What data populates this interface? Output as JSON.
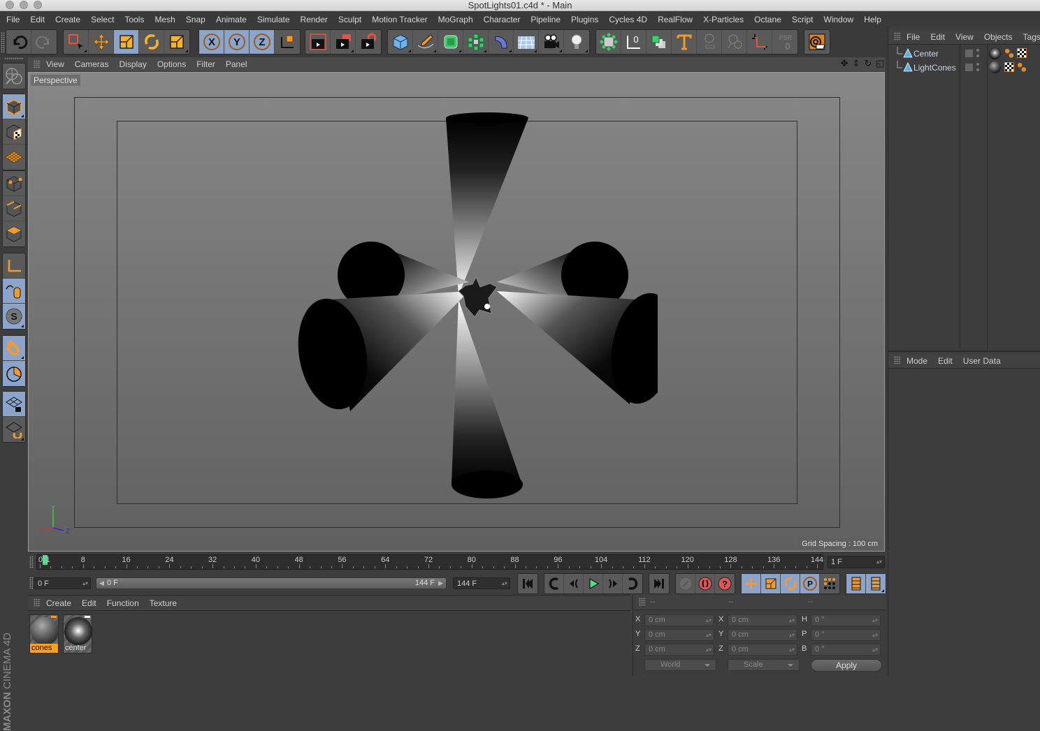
{
  "window": {
    "title": "SpotLights01.c4d * - Main"
  },
  "menubar": [
    "File",
    "Edit",
    "Create",
    "Select",
    "Tools",
    "Mesh",
    "Snap",
    "Animate",
    "Simulate",
    "Render",
    "Sculpt",
    "Motion Tracker",
    "MoGraph",
    "Character",
    "Pipeline",
    "Plugins",
    "Cycles 4D",
    "RealFlow",
    "X-Particles",
    "Octane",
    "Script",
    "Window",
    "Help"
  ],
  "toolbar": {
    "undo": "undo-icon",
    "redo": "redo-icon",
    "tools": [
      "live-selection-icon",
      "move-icon",
      "scale-icon",
      "rotate-icon",
      "last-tool-icon"
    ],
    "axis_locks": [
      "X",
      "Y",
      "Z"
    ],
    "coordinate_system": "world-coordinates-icon",
    "render": [
      "render-view-icon",
      "render-to-picture-viewer-icon",
      "render-settings-icon"
    ],
    "create": [
      "cube-icon",
      "pen-spline-icon",
      "subdivision-icon",
      "cloner-icon",
      "deformer-icon",
      "floor-icon",
      "camera-icon",
      "light-icon"
    ],
    "extra": [
      "xpresso-icon",
      "null-zero-icon",
      "instance-icon",
      "text-icon",
      "disabled-icon-1",
      "disabled-icon-2",
      "axis-icon",
      "psr-reset-icon"
    ],
    "psr_label": "PSR",
    "psr_value": "0",
    "octane": "octane-live-viewer-icon"
  },
  "left_tools": [
    "make-editable-icon",
    "model-mode-icon",
    "texture-mode-icon",
    "workplane-mode-icon",
    "points-mode-icon",
    "edges-mode-icon",
    "polygons-mode-icon",
    "axis-mode-icon",
    "tweak-mode-icon",
    "solo-mode-icon",
    "snap-icon",
    "quantize-icon",
    "lock-workplane-icon",
    "align-workplane-icon"
  ],
  "viewport": {
    "menu": [
      "View",
      "Cameras",
      "Display",
      "Options",
      "Filter",
      "Panel"
    ],
    "camera_label": "Perspective",
    "grid_spacing": "Grid Spacing : 100 cm",
    "axis": {
      "x": "X",
      "y": "Y",
      "z": "Z"
    },
    "nav_icons": [
      "pan-icon",
      "dolly-icon",
      "orbit-icon",
      "maximize-view-icon"
    ]
  },
  "timeline": {
    "ticks": [
      "0",
      "1",
      "8",
      "16",
      "24",
      "32",
      "40",
      "48",
      "56",
      "64",
      "72",
      "80",
      "88",
      "96",
      "104",
      "112",
      "120",
      "128",
      "136",
      "144"
    ],
    "current_frame": "1 F",
    "start_field": "0 F",
    "range_start": "0 F",
    "range_end": "144 F",
    "end_field": "144 F",
    "playhead_frame": 1,
    "max_frame": 144
  },
  "transport": {
    "buttons": [
      "go-to-start-icon",
      "prev-key-icon",
      "prev-frame-icon",
      "play-icon",
      "next-frame-icon",
      "next-key-icon",
      "go-to-end-icon"
    ],
    "record": [
      "record-disabled-icon",
      "autokey-icon",
      "keyframe-selection-icon"
    ],
    "key_types": [
      "key-position-icon",
      "key-scale-icon",
      "key-rotation-icon",
      "key-parameter-icon",
      "key-pla-icon"
    ],
    "extra": [
      "timeline-icon",
      "dope-sheet-icon"
    ]
  },
  "material_manager": {
    "menu": [
      "Create",
      "Edit",
      "Function",
      "Texture"
    ],
    "materials": [
      {
        "name": "cones",
        "selected": true
      },
      {
        "name": "center",
        "selected": false
      }
    ]
  },
  "coordinates": {
    "headers": [
      "--",
      "--",
      "--"
    ],
    "rows": [
      {
        "pos_label": "X",
        "pos": "0 cm",
        "size_label": "X",
        "size": "0 cm",
        "rot_label": "H",
        "rot": "0 °"
      },
      {
        "pos_label": "Y",
        "pos": "0 cm",
        "size_label": "Y",
        "size": "0 cm",
        "rot_label": "P",
        "rot": "0 °"
      },
      {
        "pos_label": "Z",
        "pos": "0 cm",
        "size_label": "Z",
        "size": "0 cm",
        "rot_label": "B",
        "rot": "0 °"
      }
    ],
    "mode_select": "World",
    "size_select": "Scale",
    "apply_label": "Apply"
  },
  "object_manager": {
    "menu": [
      "File",
      "Edit",
      "View",
      "Objects",
      "Tags"
    ],
    "objects": [
      {
        "name": "Center",
        "tags": [
          "material-tag-icon",
          "texture-tag-icon"
        ]
      },
      {
        "name": "LightCones",
        "tags": [
          "texture-tag-icon",
          "material-tag-icon"
        ]
      }
    ]
  },
  "attribute_manager": {
    "menu": [
      "Mode",
      "Edit",
      "User Data"
    ]
  },
  "brand": {
    "maxon": "MAXON",
    "product": "CINEMA 4D"
  },
  "colors": {
    "accent_orange": "#f29a2e",
    "selected_blue": "#8aa4cc",
    "playhead_green": "#4ee08a"
  }
}
